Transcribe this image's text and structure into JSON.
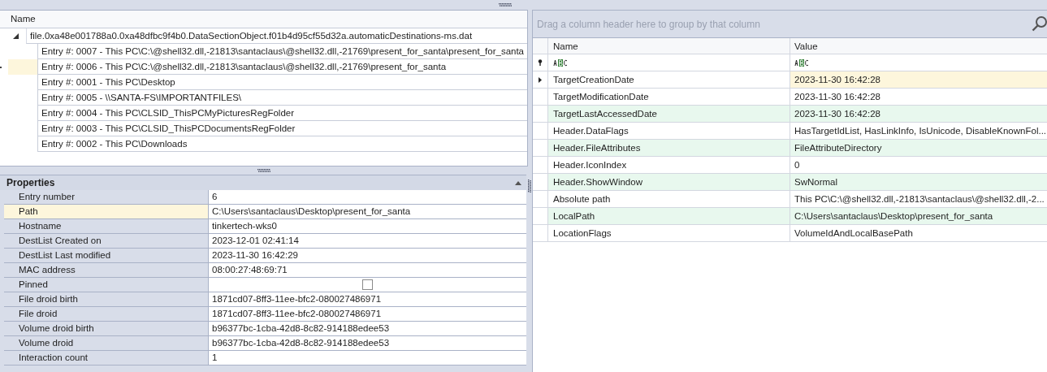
{
  "tree": {
    "column": "Name",
    "root": {
      "label": "file.0xa48e001788a0.0xa48dfbc9f4b0.DataSectionObject.f01b4d95cf55d32a.automaticDestinations-ms.dat",
      "expanded": true,
      "children": [
        {
          "label": "Entry #: 0007 - This PC\\C:\\@shell32.dll,-21813\\santaclaus\\@shell32.dll,-21769\\present_for_santa\\present_for_santa",
          "selected": false
        },
        {
          "label": "Entry #: 0006 - This PC\\C:\\@shell32.dll,-21813\\santaclaus\\@shell32.dll,-21769\\present_for_santa",
          "selected": true
        },
        {
          "label": "Entry #: 0001 - This PC\\Desktop",
          "selected": false
        },
        {
          "label": "Entry #: 0005 - \\\\SANTA-FS\\IMPORTANTFILES\\",
          "selected": false
        },
        {
          "label": "Entry #: 0004 - This PC\\CLSID_ThisPCMyPicturesRegFolder",
          "selected": false
        },
        {
          "label": "Entry #: 0003 - This PC\\CLSID_ThisPCDocumentsRegFolder",
          "selected": false
        },
        {
          "label": "Entry #: 0002 - This PC\\Downloads",
          "selected": false
        }
      ]
    }
  },
  "properties": {
    "title": "Properties",
    "expanded": true,
    "rows": [
      {
        "kind": "text",
        "name": "Entry number",
        "value": "6",
        "selected": false
      },
      {
        "kind": "text",
        "name": "Path",
        "value": "C:\\Users\\santaclaus\\Desktop\\present_for_santa",
        "selected": true
      },
      {
        "kind": "text",
        "name": "Hostname",
        "value": "tinkertech-wks0",
        "selected": false
      },
      {
        "kind": "text",
        "name": "DestList Created on",
        "value": "2023-12-01 02:41:14",
        "selected": false
      },
      {
        "kind": "text",
        "name": "DestList Last modified",
        "value": "2023-11-30 16:42:29",
        "selected": false
      },
      {
        "kind": "text",
        "name": "MAC address",
        "value": "08:00:27:48:69:71",
        "selected": false
      },
      {
        "kind": "checkbox",
        "name": "Pinned",
        "checked": false,
        "selected": false
      },
      {
        "kind": "text",
        "name": "File droid birth",
        "value": "1871cd07-8ff3-11ee-bfc2-080027486971",
        "selected": false
      },
      {
        "kind": "text",
        "name": "File droid",
        "value": "1871cd07-8ff3-11ee-bfc2-080027486971",
        "selected": false
      },
      {
        "kind": "text",
        "name": "Volume droid birth",
        "value": "b96377bc-1cba-42d8-8c82-914188edee53",
        "selected": false
      },
      {
        "kind": "text",
        "name": "Volume droid",
        "value": "b96377bc-1cba-42d8-8c82-914188edee53",
        "selected": false
      },
      {
        "kind": "text",
        "name": "Interaction count",
        "value": "1",
        "selected": false
      }
    ]
  },
  "grid": {
    "group_panel": {
      "placeholder": "Drag a column header here to group by that column"
    },
    "columns": [
      "Name",
      "Value"
    ],
    "rows": [
      {
        "name": "TargetCreationDate",
        "value": "2023-11-30 16:42:28",
        "selected": true
      },
      {
        "name": "TargetModificationDate",
        "value": "2023-11-30 16:42:28",
        "selected": false
      },
      {
        "name": "TargetLastAccessedDate",
        "value": "2023-11-30 16:42:28",
        "selected": false
      },
      {
        "name": "Header.DataFlags",
        "value": "HasTargetIdList, HasLinkInfo, IsUnicode, DisableKnownFol...",
        "selected": false
      },
      {
        "name": "Header.FileAttributes",
        "value": "FileAttributeDirectory",
        "selected": false
      },
      {
        "name": "Header.IconIndex",
        "value": "0",
        "selected": false
      },
      {
        "name": "Header.ShowWindow",
        "value": "SwNormal",
        "selected": false
      },
      {
        "name": "Absolute path",
        "value": "This PC\\C:\\@shell32.dll,-21813\\santaclaus\\@shell32.dll,-2...",
        "selected": false
      },
      {
        "name": "LocalPath",
        "value": "C:\\Users\\santaclaus\\Desktop\\present_for_santa",
        "selected": false
      },
      {
        "name": "LocationFlags",
        "value": "VolumeIdAndLocalBasePath",
        "selected": false
      }
    ]
  }
}
